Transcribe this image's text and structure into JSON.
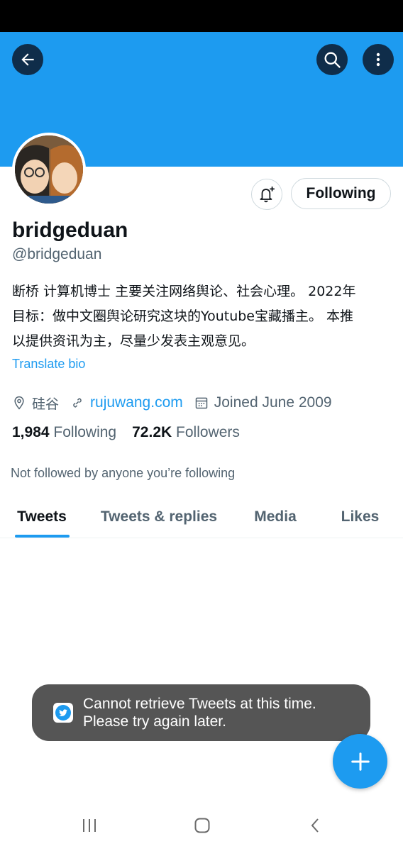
{
  "header": {
    "back_icon": "arrow-left-icon",
    "search_icon": "search-icon",
    "more_icon": "more-vertical-icon",
    "banner_color": "#1d9bf0"
  },
  "profile": {
    "display_name": "bridgeduan",
    "handle": "@bridgeduan",
    "bio_lines": [
      "断桥 计算机博士 主要关注网络舆论、社会心理。 2022年",
      "目标：做中文圈舆论研究这块的Youtube宝藏播主。 本推",
      "以提供资讯为主，尽量少发表主观意见。"
    ],
    "translate_label": "Translate bio",
    "location": "硅谷",
    "website": "rujuwang.com",
    "joined": "Joined June 2009",
    "following_count": "1,984",
    "following_label": "Following",
    "followers_count": "72.2K",
    "followers_label": "Followers",
    "not_followed_text": "Not followed by anyone you’re following"
  },
  "actions": {
    "notify_icon": "bell-plus-icon",
    "follow_button_label": "Following"
  },
  "tabs": [
    {
      "label": "Tweets",
      "active": true
    },
    {
      "label": "Tweets & replies",
      "active": false
    },
    {
      "label": "Media",
      "active": false
    },
    {
      "label": "Likes",
      "active": false
    }
  ],
  "toast": {
    "line1": "Cannot retrieve Tweets at this time.",
    "line2": "Please try again later."
  },
  "fab": {
    "icon": "plus-icon"
  },
  "navbar": {
    "recents_icon": "recents-icon",
    "home_icon": "home-icon",
    "back_icon": "chevron-left-icon"
  },
  "colors": {
    "accent": "#1d9bf0",
    "toast_bg": "#555555",
    "secondary_text": "#536471"
  }
}
